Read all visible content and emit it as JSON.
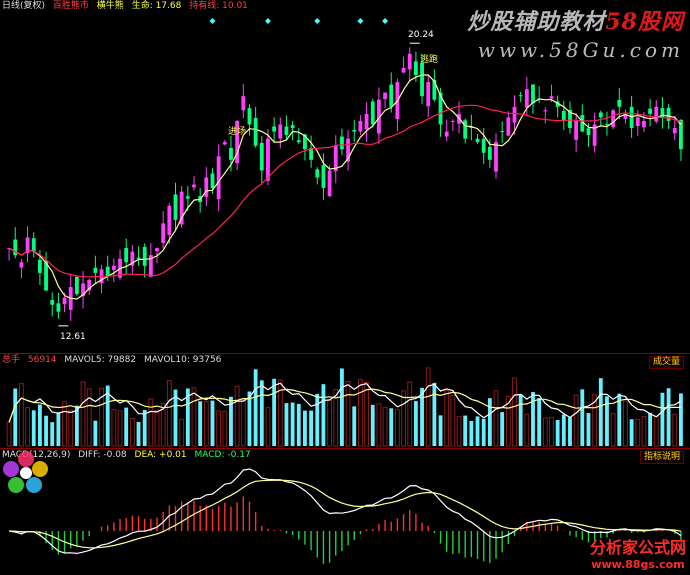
{
  "price_header": {
    "period": "日线(复权)",
    "indicator_name": "百胜熊市",
    "status": "横牛熊",
    "lifeline_label": "生命: 17.68",
    "sell_label": "持有线: 10.01"
  },
  "volume_header": {
    "title": "总手",
    "value": "56914",
    "mavol5": "MAVOL5: 79882",
    "mavol10": "MAVOL10: 93756",
    "tag": "成交量"
  },
  "macd_header": {
    "title": "MACD(12,26,9)",
    "diff": "DIFF: -0.08",
    "dea": "DEA: +0.01",
    "macd": "MACD: -0.17",
    "tag": "指标说明"
  },
  "annotations": {
    "high": "20.24",
    "low": "12.61",
    "escape": "逃跑",
    "buy": "进场"
  },
  "watermark": {
    "top_text_1": "炒股辅助教材",
    "top_text_2": "58股网",
    "top_url": "www.58Gu.com",
    "bottom_text": "分析家公式网",
    "bottom_url": "www.88gs.com"
  },
  "colors": {
    "up": "#ff40ff",
    "down": "#00ff7f",
    "vol_up": "#8b1a1a",
    "vol_down": "#66f0ff",
    "ma_fast": "#ffff99",
    "ma_slow": "#ff2050",
    "diamond": "#40ffff"
  },
  "chart_data": {
    "type": "candlestick",
    "ylim": [
      12.0,
      21.0
    ],
    "closes": [
      14.6,
      14.4,
      14.2,
      14.9,
      14.5,
      13.9,
      13.4,
      13.0,
      12.8,
      13.2,
      13.5,
      13.3,
      13.6,
      13.7,
      13.9,
      14.0,
      13.8,
      14.1,
      14.3,
      14.2,
      14.5,
      14.3,
      14.1,
      14.4,
      14.6,
      15.3,
      15.8,
      15.4,
      16.2,
      16.0,
      16.4,
      15.9,
      16.6,
      16.3,
      17.2,
      17.6,
      17.1,
      18.2,
      18.9,
      18.1,
      17.5,
      16.8,
      17.7,
      17.9,
      18.1,
      17.8,
      18.0,
      17.6,
      17.4,
      17.1,
      16.6,
      16.3,
      16.8,
      17.5,
      17.4,
      17.7,
      17.9,
      18.2,
      18.4,
      18.1,
      18.8,
      19.0,
      18.6,
      19.3,
      19.7,
      20.1,
      19.5,
      18.9,
      19.3,
      18.8,
      18.1,
      17.9,
      18.2,
      18.4,
      17.7,
      18.0,
      17.6,
      17.3,
      17.1,
      17.6,
      17.9,
      18.3,
      18.6,
      18.9,
      19.1,
      18.7,
      18.8,
      18.5,
      18.9,
      18.6,
      18.2,
      18.0,
      18.2,
      17.9,
      17.8,
      18.1,
      18.3,
      18.1,
      18.5,
      18.6,
      18.4,
      18.0,
      18.3,
      18.2,
      18.4,
      18.6,
      18.3,
      18.2,
      18.0,
      17.4
    ]
  }
}
